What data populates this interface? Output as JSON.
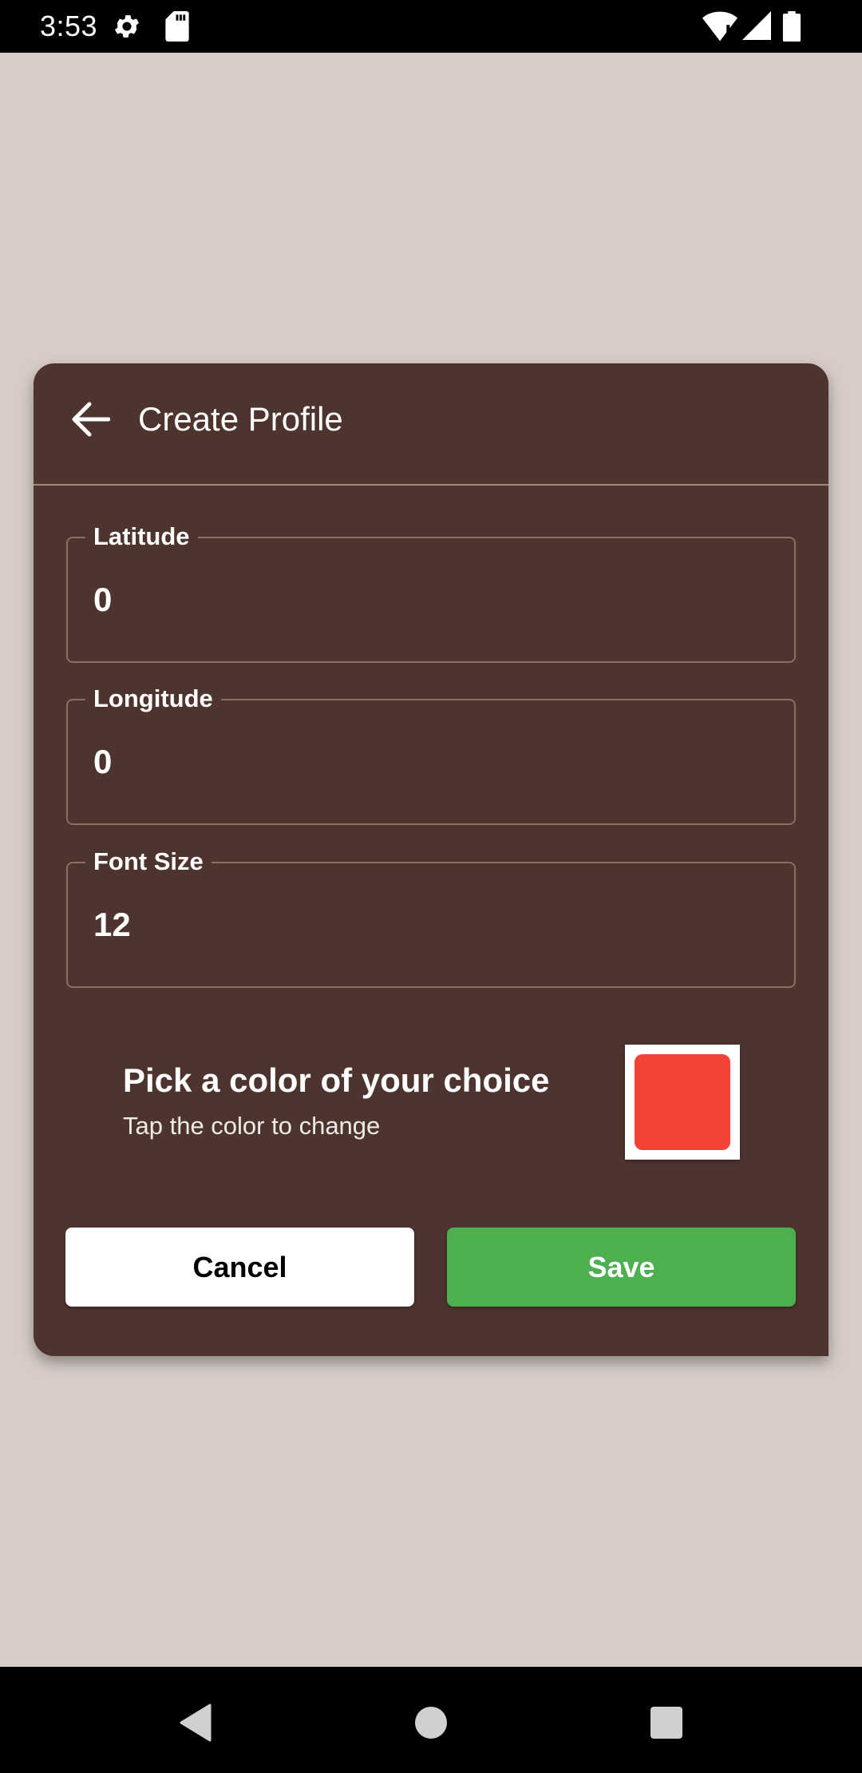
{
  "status_bar": {
    "time": "3:53",
    "icons": [
      "settings-icon",
      "sd-card-icon",
      "wifi-icon",
      "signal-icon",
      "battery-icon"
    ]
  },
  "dialog": {
    "title": "Create Profile",
    "back_icon": "arrow-left-icon",
    "fields": [
      {
        "label": "Latitude",
        "value": "0"
      },
      {
        "label": "Longitude",
        "value": "0"
      },
      {
        "label": "Font Size",
        "value": "12"
      }
    ],
    "color_picker": {
      "heading": "Pick a color of your choice",
      "subtext": "Tap the color to change",
      "selected_color": "#f44336"
    },
    "buttons": {
      "cancel_label": "Cancel",
      "save_label": "Save"
    }
  },
  "colors": {
    "background": "#d7ccc8",
    "dialog": "#4e342e",
    "save_button": "#4caf50"
  },
  "nav_bar": {
    "icons": [
      "back-triangle-icon",
      "home-circle-icon",
      "recents-square-icon"
    ]
  }
}
